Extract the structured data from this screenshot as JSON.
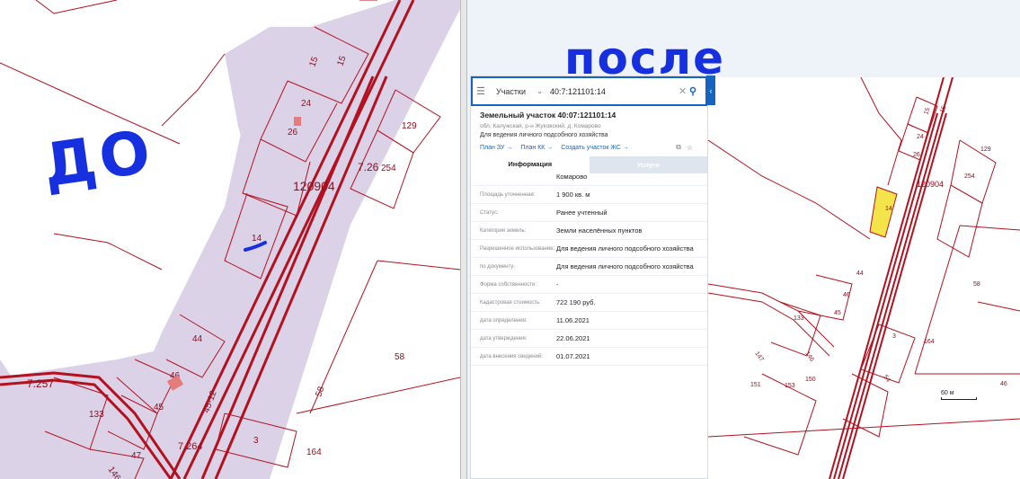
{
  "annotations": {
    "before": "ДО",
    "after": "после"
  },
  "search": {
    "type_label": "Участки",
    "query": "40:7:121101:14"
  },
  "card": {
    "title": "Земельный участок 40:07:121101:14",
    "address": "обл. Калужская, р-н Жуковский, д. Комарово",
    "use": "Для ведения личного подсобного хозяйства",
    "links": [
      "План ЗУ →",
      "План КК →",
      "Создать участок ЖС →"
    ]
  },
  "tabs": [
    "Информация",
    "Услуги"
  ],
  "info_rows": [
    {
      "key": "",
      "value": "Комарово"
    },
    {
      "key": "Площадь уточненная:",
      "value": "1 900 кв. м"
    },
    {
      "key": "Статус:",
      "value": "Ранее учтенный"
    },
    {
      "key": "Категория земель:",
      "value": "Земли населённых пунктов"
    },
    {
      "key": "Разрешенное использование:",
      "value": "Для ведения личного подсобного хозяйства"
    },
    {
      "key": "по документу:",
      "value": "Для ведения личного подсобного хозяйства"
    },
    {
      "key": "Форма собственности:",
      "value": "-"
    },
    {
      "key": "Кадастровая стоимость:",
      "value": "722 190 руб."
    },
    {
      "key": "дата определения:",
      "value": "11.06.2021"
    },
    {
      "key": "дата утверждения:",
      "value": "22.06.2021"
    },
    {
      "key": "дата внесения сведений:",
      "value": "01.07.2021"
    }
  ],
  "scale_label": "60 м",
  "left_map_labels": [
    "15",
    "15",
    "24",
    "26",
    "129",
    "7.26",
    "254",
    "120904",
    "14",
    "44",
    "46",
    "45",
    "58",
    "58",
    "7.257",
    "133",
    "45-12",
    "7.264",
    "3",
    "164",
    "47",
    "146"
  ],
  "right_map_labels": [
    "15",
    "15",
    "24",
    "26",
    "129",
    "254",
    "120904",
    "14",
    "44",
    "46",
    "45",
    "133",
    "58",
    "3",
    "164",
    "146",
    "151",
    "153",
    "150",
    "54",
    "147",
    "46"
  ],
  "colors": {
    "parcel_fill": "#dcd2e8",
    "parcel_line": "#b3111f",
    "selected": "#f5e34a",
    "accent": "#1565c0"
  }
}
